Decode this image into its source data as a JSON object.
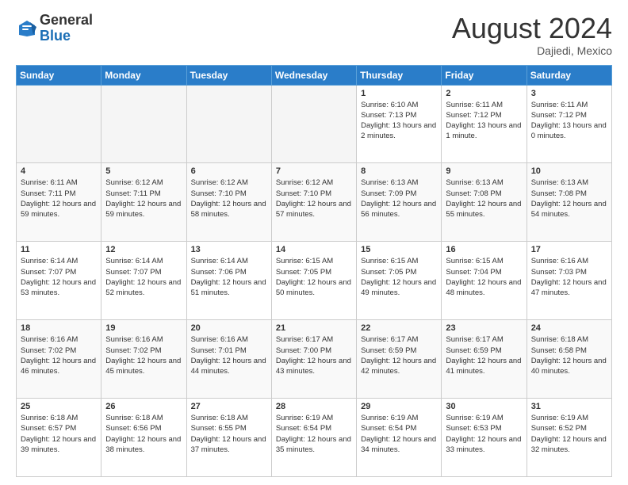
{
  "header": {
    "logo_line1": "General",
    "logo_line2": "Blue",
    "month_year": "August 2024",
    "location": "Dajiedi, Mexico"
  },
  "days_of_week": [
    "Sunday",
    "Monday",
    "Tuesday",
    "Wednesday",
    "Thursday",
    "Friday",
    "Saturday"
  ],
  "weeks": [
    [
      {
        "day": "",
        "sunrise": "",
        "sunset": "",
        "daylight": "",
        "empty": true
      },
      {
        "day": "",
        "sunrise": "",
        "sunset": "",
        "daylight": "",
        "empty": true
      },
      {
        "day": "",
        "sunrise": "",
        "sunset": "",
        "daylight": "",
        "empty": true
      },
      {
        "day": "",
        "sunrise": "",
        "sunset": "",
        "daylight": "",
        "empty": true
      },
      {
        "day": "1",
        "sunrise": "Sunrise: 6:10 AM",
        "sunset": "Sunset: 7:13 PM",
        "daylight": "Daylight: 13 hours and 2 minutes.",
        "empty": false
      },
      {
        "day": "2",
        "sunrise": "Sunrise: 6:11 AM",
        "sunset": "Sunset: 7:12 PM",
        "daylight": "Daylight: 13 hours and 1 minute.",
        "empty": false
      },
      {
        "day": "3",
        "sunrise": "Sunrise: 6:11 AM",
        "sunset": "Sunset: 7:12 PM",
        "daylight": "Daylight: 13 hours and 0 minutes.",
        "empty": false
      }
    ],
    [
      {
        "day": "4",
        "sunrise": "Sunrise: 6:11 AM",
        "sunset": "Sunset: 7:11 PM",
        "daylight": "Daylight: 12 hours and 59 minutes.",
        "empty": false
      },
      {
        "day": "5",
        "sunrise": "Sunrise: 6:12 AM",
        "sunset": "Sunset: 7:11 PM",
        "daylight": "Daylight: 12 hours and 59 minutes.",
        "empty": false
      },
      {
        "day": "6",
        "sunrise": "Sunrise: 6:12 AM",
        "sunset": "Sunset: 7:10 PM",
        "daylight": "Daylight: 12 hours and 58 minutes.",
        "empty": false
      },
      {
        "day": "7",
        "sunrise": "Sunrise: 6:12 AM",
        "sunset": "Sunset: 7:10 PM",
        "daylight": "Daylight: 12 hours and 57 minutes.",
        "empty": false
      },
      {
        "day": "8",
        "sunrise": "Sunrise: 6:13 AM",
        "sunset": "Sunset: 7:09 PM",
        "daylight": "Daylight: 12 hours and 56 minutes.",
        "empty": false
      },
      {
        "day": "9",
        "sunrise": "Sunrise: 6:13 AM",
        "sunset": "Sunset: 7:08 PM",
        "daylight": "Daylight: 12 hours and 55 minutes.",
        "empty": false
      },
      {
        "day": "10",
        "sunrise": "Sunrise: 6:13 AM",
        "sunset": "Sunset: 7:08 PM",
        "daylight": "Daylight: 12 hours and 54 minutes.",
        "empty": false
      }
    ],
    [
      {
        "day": "11",
        "sunrise": "Sunrise: 6:14 AM",
        "sunset": "Sunset: 7:07 PM",
        "daylight": "Daylight: 12 hours and 53 minutes.",
        "empty": false
      },
      {
        "day": "12",
        "sunrise": "Sunrise: 6:14 AM",
        "sunset": "Sunset: 7:07 PM",
        "daylight": "Daylight: 12 hours and 52 minutes.",
        "empty": false
      },
      {
        "day": "13",
        "sunrise": "Sunrise: 6:14 AM",
        "sunset": "Sunset: 7:06 PM",
        "daylight": "Daylight: 12 hours and 51 minutes.",
        "empty": false
      },
      {
        "day": "14",
        "sunrise": "Sunrise: 6:15 AM",
        "sunset": "Sunset: 7:05 PM",
        "daylight": "Daylight: 12 hours and 50 minutes.",
        "empty": false
      },
      {
        "day": "15",
        "sunrise": "Sunrise: 6:15 AM",
        "sunset": "Sunset: 7:05 PM",
        "daylight": "Daylight: 12 hours and 49 minutes.",
        "empty": false
      },
      {
        "day": "16",
        "sunrise": "Sunrise: 6:15 AM",
        "sunset": "Sunset: 7:04 PM",
        "daylight": "Daylight: 12 hours and 48 minutes.",
        "empty": false
      },
      {
        "day": "17",
        "sunrise": "Sunrise: 6:16 AM",
        "sunset": "Sunset: 7:03 PM",
        "daylight": "Daylight: 12 hours and 47 minutes.",
        "empty": false
      }
    ],
    [
      {
        "day": "18",
        "sunrise": "Sunrise: 6:16 AM",
        "sunset": "Sunset: 7:02 PM",
        "daylight": "Daylight: 12 hours and 46 minutes.",
        "empty": false
      },
      {
        "day": "19",
        "sunrise": "Sunrise: 6:16 AM",
        "sunset": "Sunset: 7:02 PM",
        "daylight": "Daylight: 12 hours and 45 minutes.",
        "empty": false
      },
      {
        "day": "20",
        "sunrise": "Sunrise: 6:16 AM",
        "sunset": "Sunset: 7:01 PM",
        "daylight": "Daylight: 12 hours and 44 minutes.",
        "empty": false
      },
      {
        "day": "21",
        "sunrise": "Sunrise: 6:17 AM",
        "sunset": "Sunset: 7:00 PM",
        "daylight": "Daylight: 12 hours and 43 minutes.",
        "empty": false
      },
      {
        "day": "22",
        "sunrise": "Sunrise: 6:17 AM",
        "sunset": "Sunset: 6:59 PM",
        "daylight": "Daylight: 12 hours and 42 minutes.",
        "empty": false
      },
      {
        "day": "23",
        "sunrise": "Sunrise: 6:17 AM",
        "sunset": "Sunset: 6:59 PM",
        "daylight": "Daylight: 12 hours and 41 minutes.",
        "empty": false
      },
      {
        "day": "24",
        "sunrise": "Sunrise: 6:18 AM",
        "sunset": "Sunset: 6:58 PM",
        "daylight": "Daylight: 12 hours and 40 minutes.",
        "empty": false
      }
    ],
    [
      {
        "day": "25",
        "sunrise": "Sunrise: 6:18 AM",
        "sunset": "Sunset: 6:57 PM",
        "daylight": "Daylight: 12 hours and 39 minutes.",
        "empty": false
      },
      {
        "day": "26",
        "sunrise": "Sunrise: 6:18 AM",
        "sunset": "Sunset: 6:56 PM",
        "daylight": "Daylight: 12 hours and 38 minutes.",
        "empty": false
      },
      {
        "day": "27",
        "sunrise": "Sunrise: 6:18 AM",
        "sunset": "Sunset: 6:55 PM",
        "daylight": "Daylight: 12 hours and 37 minutes.",
        "empty": false
      },
      {
        "day": "28",
        "sunrise": "Sunrise: 6:19 AM",
        "sunset": "Sunset: 6:54 PM",
        "daylight": "Daylight: 12 hours and 35 minutes.",
        "empty": false
      },
      {
        "day": "29",
        "sunrise": "Sunrise: 6:19 AM",
        "sunset": "Sunset: 6:54 PM",
        "daylight": "Daylight: 12 hours and 34 minutes.",
        "empty": false
      },
      {
        "day": "30",
        "sunrise": "Sunrise: 6:19 AM",
        "sunset": "Sunset: 6:53 PM",
        "daylight": "Daylight: 12 hours and 33 minutes.",
        "empty": false
      },
      {
        "day": "31",
        "sunrise": "Sunrise: 6:19 AM",
        "sunset": "Sunset: 6:52 PM",
        "daylight": "Daylight: 12 hours and 32 minutes.",
        "empty": false
      }
    ]
  ]
}
